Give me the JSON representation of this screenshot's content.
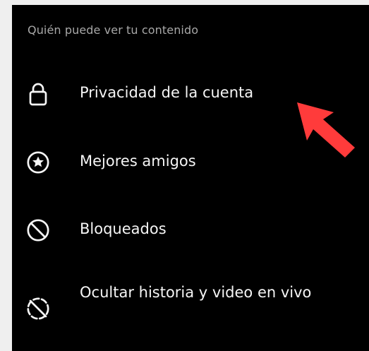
{
  "section": {
    "title": "Quién puede ver tu contenido"
  },
  "menu": {
    "items": [
      {
        "label": "Privacidad de la cuenta",
        "icon": "lock-icon"
      },
      {
        "label": "Mejores amigos",
        "icon": "star-circle-icon"
      },
      {
        "label": "Bloqueados",
        "icon": "blocked-icon"
      },
      {
        "label": "Ocultar historia y video en vivo",
        "icon": "hide-story-icon"
      }
    ]
  },
  "colors": {
    "panel_background": "#000000",
    "page_background": "#efefef",
    "text": "#f5f5f5",
    "muted_text": "#a8a8a8",
    "arrow": "#ff3b3b"
  }
}
